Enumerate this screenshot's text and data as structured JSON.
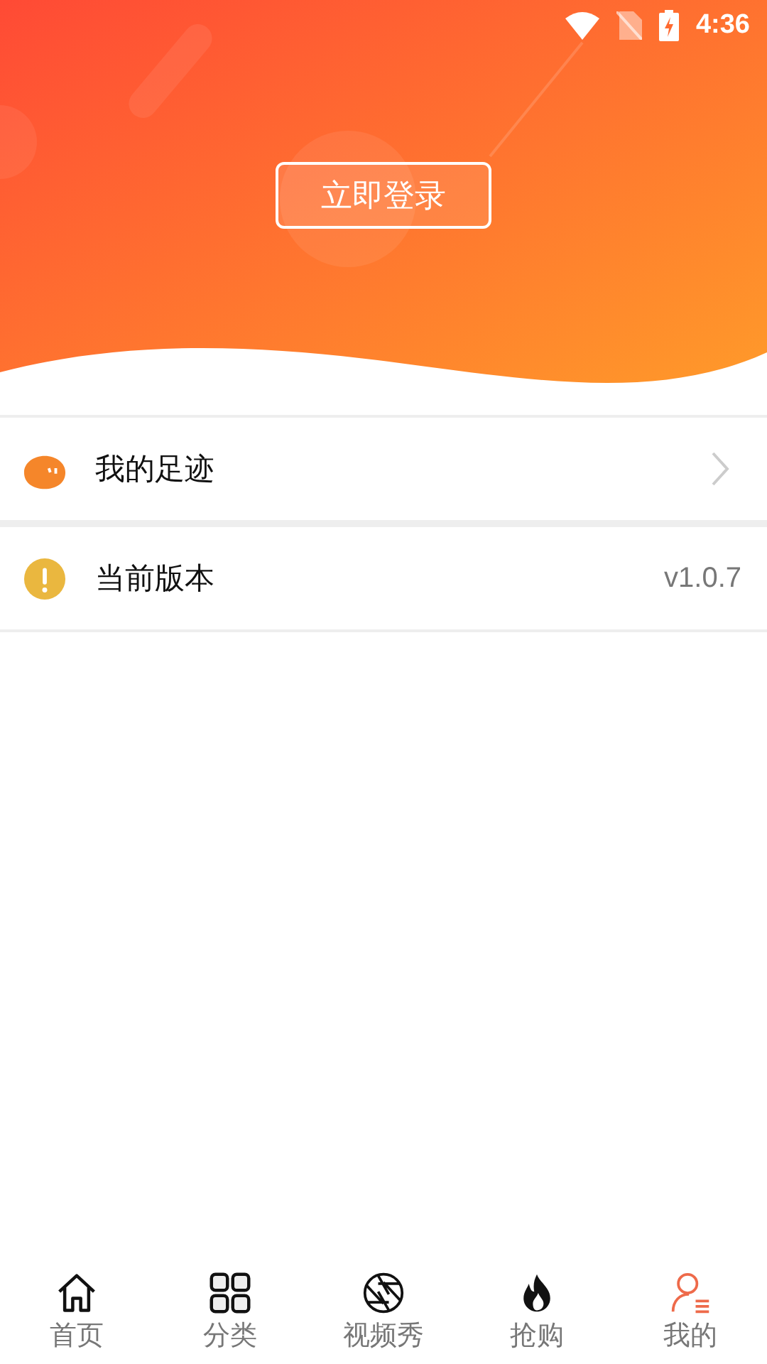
{
  "status_bar": {
    "time": "4:36"
  },
  "header": {
    "login_button": "立即登录"
  },
  "menu": [
    {
      "kind": "footprint",
      "label": "我的足迹",
      "chevron": true
    },
    {
      "kind": "version",
      "label": "当前版本",
      "value": "v1.0.7"
    }
  ],
  "tabs": [
    {
      "kind": "home",
      "label": "首页",
      "selected": false
    },
    {
      "kind": "grid",
      "label": "分类",
      "selected": false
    },
    {
      "kind": "aperture",
      "label": "视频秀",
      "selected": false
    },
    {
      "kind": "flame",
      "label": "抢购",
      "selected": false
    },
    {
      "kind": "user",
      "label": "我的",
      "selected": true
    }
  ]
}
